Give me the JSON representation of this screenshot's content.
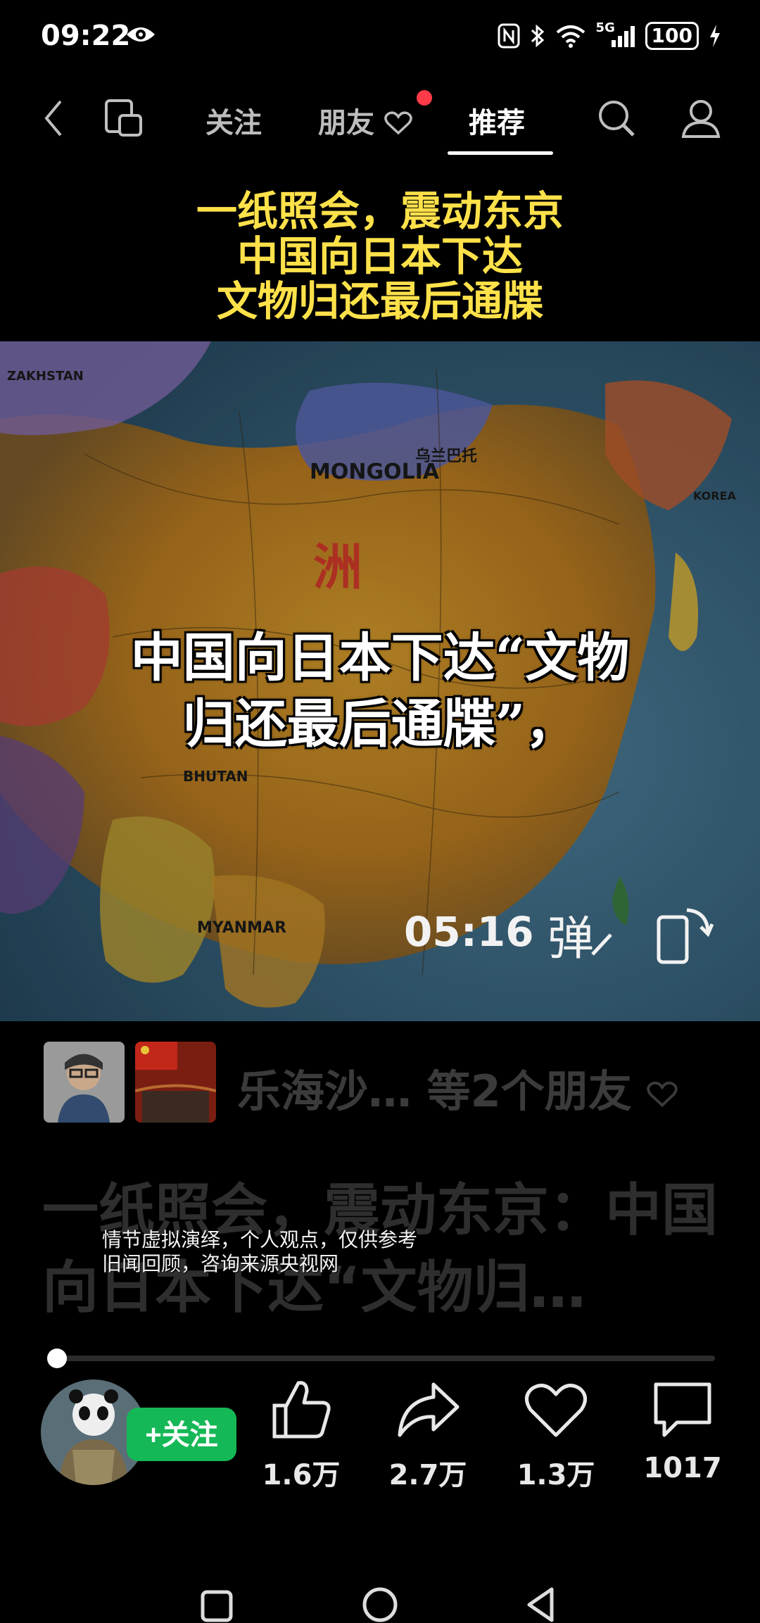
{
  "status_bar": {
    "time": "09:22",
    "network": "5G",
    "battery": "100"
  },
  "top_nav": {
    "tabs": [
      {
        "label": "关注"
      },
      {
        "label": "朋友"
      },
      {
        "label": "推荐"
      }
    ],
    "active_tab": "推荐"
  },
  "video": {
    "headline_lines": [
      "一纸照会，震动东京",
      "中国向日本下达",
      "文物归还最后通牒"
    ],
    "subtitle_lines": [
      "中国向日本下达“文物",
      "归还最后通牒”，"
    ],
    "duration": "05:16",
    "danmu_label": "弹",
    "map_labels": [
      "MONGOLIA",
      "ZAKHSTAN",
      "MYANMAR",
      "BHUTAN",
      "KOREA",
      "洲",
      "乌兰巴托"
    ]
  },
  "overlay": {
    "friends_text": "乐海沙…  等2个朋友",
    "title": "一纸照会，震动东京：中国向日本下达“文物归…",
    "notice_lines": [
      "情节虚拟演绎，个人观点，仅供参考",
      "旧闻回顾，咨询来源央视网"
    ],
    "progress": 0.01
  },
  "author": {
    "name_fragment": "…",
    "follow_label": "+关注"
  },
  "actions": [
    {
      "name": "like",
      "count": "1.6万"
    },
    {
      "name": "share",
      "count": "2.7万"
    },
    {
      "name": "favorite",
      "count": "1.3万"
    },
    {
      "name": "comment",
      "count": "1017"
    }
  ],
  "colors": {
    "headline": "#ffe14a",
    "follow": "#15b856",
    "notification_dot": "#ff3b4a"
  },
  "icons": [
    "eye-icon",
    "nfc-icon",
    "bluetooth-icon",
    "wifi-icon",
    "signal-icon",
    "battery-icon",
    "back-icon",
    "multiscreen-icon",
    "search-icon",
    "profile-icon",
    "heart-icon",
    "rotate-icon",
    "like-icon",
    "share-icon",
    "favorite-icon",
    "comment-icon",
    "recents-icon",
    "home-icon",
    "nav-back-icon"
  ]
}
